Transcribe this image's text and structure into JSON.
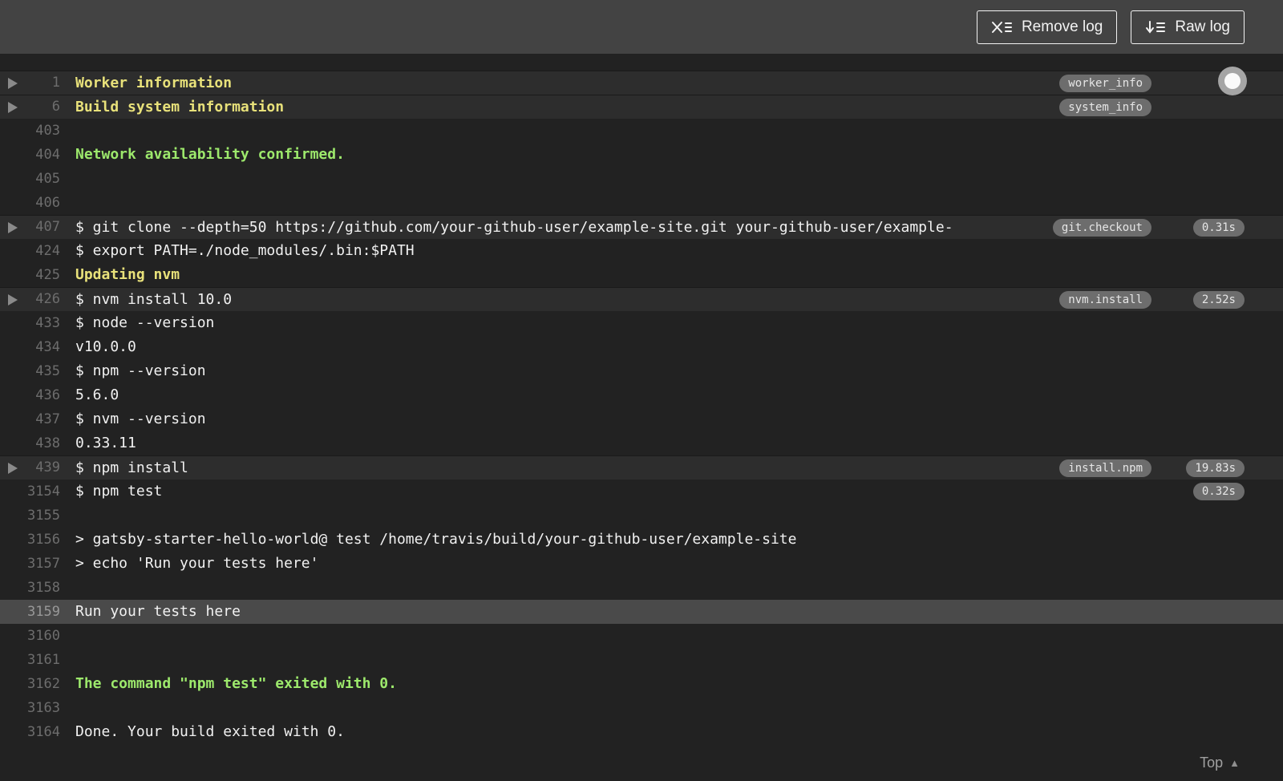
{
  "toolbar": {
    "remove_log_label": "Remove log",
    "raw_log_label": "Raw log"
  },
  "log": {
    "top_link_label": "Top",
    "rows": [
      {
        "num": "1",
        "text": "Worker information",
        "style": "yellow",
        "fold": true,
        "tag": "worker_info"
      },
      {
        "num": "6",
        "text": "Build system information",
        "style": "yellow",
        "fold": true,
        "tag": "system_info"
      },
      {
        "num": "403",
        "text": ""
      },
      {
        "num": "404",
        "text": "Network availability confirmed.",
        "style": "green"
      },
      {
        "num": "405",
        "text": ""
      },
      {
        "num": "406",
        "text": ""
      },
      {
        "num": "407",
        "text": "$ git clone --depth=50 https://github.com/your-github-user/example-site.git your-github-user/example-",
        "fold": true,
        "tag": "git.checkout",
        "duration": "0.31s"
      },
      {
        "num": "424",
        "text": "$ export PATH=./node_modules/.bin:$PATH"
      },
      {
        "num": "425",
        "text": "Updating nvm",
        "style": "yellow"
      },
      {
        "num": "426",
        "text": "$ nvm install 10.0",
        "fold": true,
        "tag": "nvm.install",
        "duration": "2.52s"
      },
      {
        "num": "433",
        "text": "$ node --version"
      },
      {
        "num": "434",
        "text": "v10.0.0"
      },
      {
        "num": "435",
        "text": "$ npm --version"
      },
      {
        "num": "436",
        "text": "5.6.0"
      },
      {
        "num": "437",
        "text": "$ nvm --version"
      },
      {
        "num": "438",
        "text": "0.33.11"
      },
      {
        "num": "439",
        "text": "$ npm install",
        "fold": true,
        "tag": "install.npm",
        "duration": "19.83s"
      },
      {
        "num": "3154",
        "text": "$ npm test",
        "duration": "0.32s"
      },
      {
        "num": "3155",
        "text": ""
      },
      {
        "num": "3156",
        "text": "> gatsby-starter-hello-world@ test /home/travis/build/your-github-user/example-site"
      },
      {
        "num": "3157",
        "text": "> echo 'Run your tests here'"
      },
      {
        "num": "3158",
        "text": ""
      },
      {
        "num": "3159",
        "text": "Run your tests here",
        "highlight": true
      },
      {
        "num": "3160",
        "text": ""
      },
      {
        "num": "3161",
        "text": ""
      },
      {
        "num": "3162",
        "text": "The command \"npm test\" exited with 0.",
        "style": "green"
      },
      {
        "num": "3163",
        "text": ""
      },
      {
        "num": "3164",
        "text": "Done. Your build exited with 0."
      }
    ]
  },
  "colors": {
    "topbar_bg": "#434343",
    "log_bg": "#222222",
    "fold_row_bg": "#2d2d2d",
    "highlight_row_bg": "#4a4a4a",
    "section_header_yellow": "#e8e17a",
    "success_green": "#9de96c",
    "pill_bg": "#6d6d6d",
    "line_number_gray": "#6d6d6d",
    "text_white": "#f1f1f1"
  },
  "icons": {
    "remove_log": "x-with-list-icon",
    "raw_log": "down-arrow-with-list-icon",
    "fold_arrow": "right-triangle-icon",
    "top": "up-triangle-icon"
  }
}
